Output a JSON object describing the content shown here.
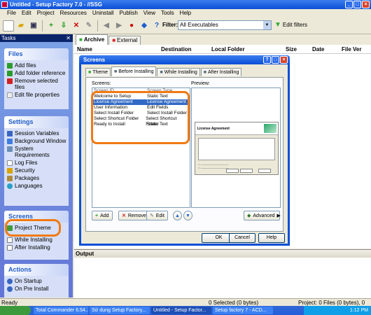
{
  "window": {
    "title": "Untitled - Setup Factory 7.0 - //SSG"
  },
  "menu": [
    "File",
    "Edit",
    "Project",
    "Resources",
    "Uninstall",
    "Publish",
    "View",
    "Tools",
    "Help"
  ],
  "toolbar": {
    "filter_label": "Filter:",
    "filter_value": "All Executables",
    "edit_filters": "Edit filters"
  },
  "tasks": {
    "header": "Tasks",
    "files": {
      "title": "Files",
      "items": [
        "Add files",
        "Add folder reference",
        "Remove selected files",
        "Edit file properties"
      ]
    },
    "settings": {
      "title": "Settings",
      "items": [
        "Session Variables",
        "Background Window",
        "System Requirements",
        "Log Files",
        "Security",
        "Packages",
        "Languages"
      ]
    },
    "screens": {
      "title": "Screens",
      "items": [
        "Project Theme",
        "While Installing",
        "After Installing"
      ]
    },
    "actions": {
      "title": "Actions",
      "items": [
        "On Startup",
        "On Pre Install"
      ]
    }
  },
  "content": {
    "tabs": [
      "Archive",
      "External"
    ],
    "columns": [
      "Name",
      "Destination",
      "Local Folder",
      "Size",
      "Date",
      "File Ver"
    ]
  },
  "output": {
    "title": "Output"
  },
  "status": {
    "left": "Ready",
    "mid": "0 Selected (0 bytes)",
    "right": "Project: 0 Files (0 bytes), 0 Folders"
  },
  "taskbar": {
    "items": [
      "Total Commander 6.54...",
      "Sử dụng Setup Factory...",
      "Untitled - Setup Factor...",
      "Setup factory 7 - ACD..."
    ],
    "time": "1:12 PM"
  },
  "dialog": {
    "title": "Screens",
    "tabs": [
      "Theme",
      "Before Installing",
      "While Installing",
      "After Installing"
    ],
    "screens_label": "Screens:",
    "preview_label": "Preview:",
    "list_header": [
      "Screen ID",
      "Screen Type"
    ],
    "rows": [
      [
        "Welcome to Setup",
        "Static Text"
      ],
      [
        "License Agreement",
        "License Agreement"
      ],
      [
        "User Information",
        "Edit Fields"
      ],
      [
        "Select Install Folder",
        "Select Install Folder"
      ],
      [
        "Select Shortcut Folder",
        "Select Shortcut Folder"
      ],
      [
        "Ready to Install",
        "Static Text"
      ]
    ],
    "selected_row": 1,
    "preview_title": "License Agreement",
    "buttons": {
      "add": "Add",
      "remove": "Remove",
      "edit": "Edit",
      "advanced": "Advanced",
      "ok": "OK",
      "cancel": "Cancel",
      "help": "Help"
    }
  }
}
